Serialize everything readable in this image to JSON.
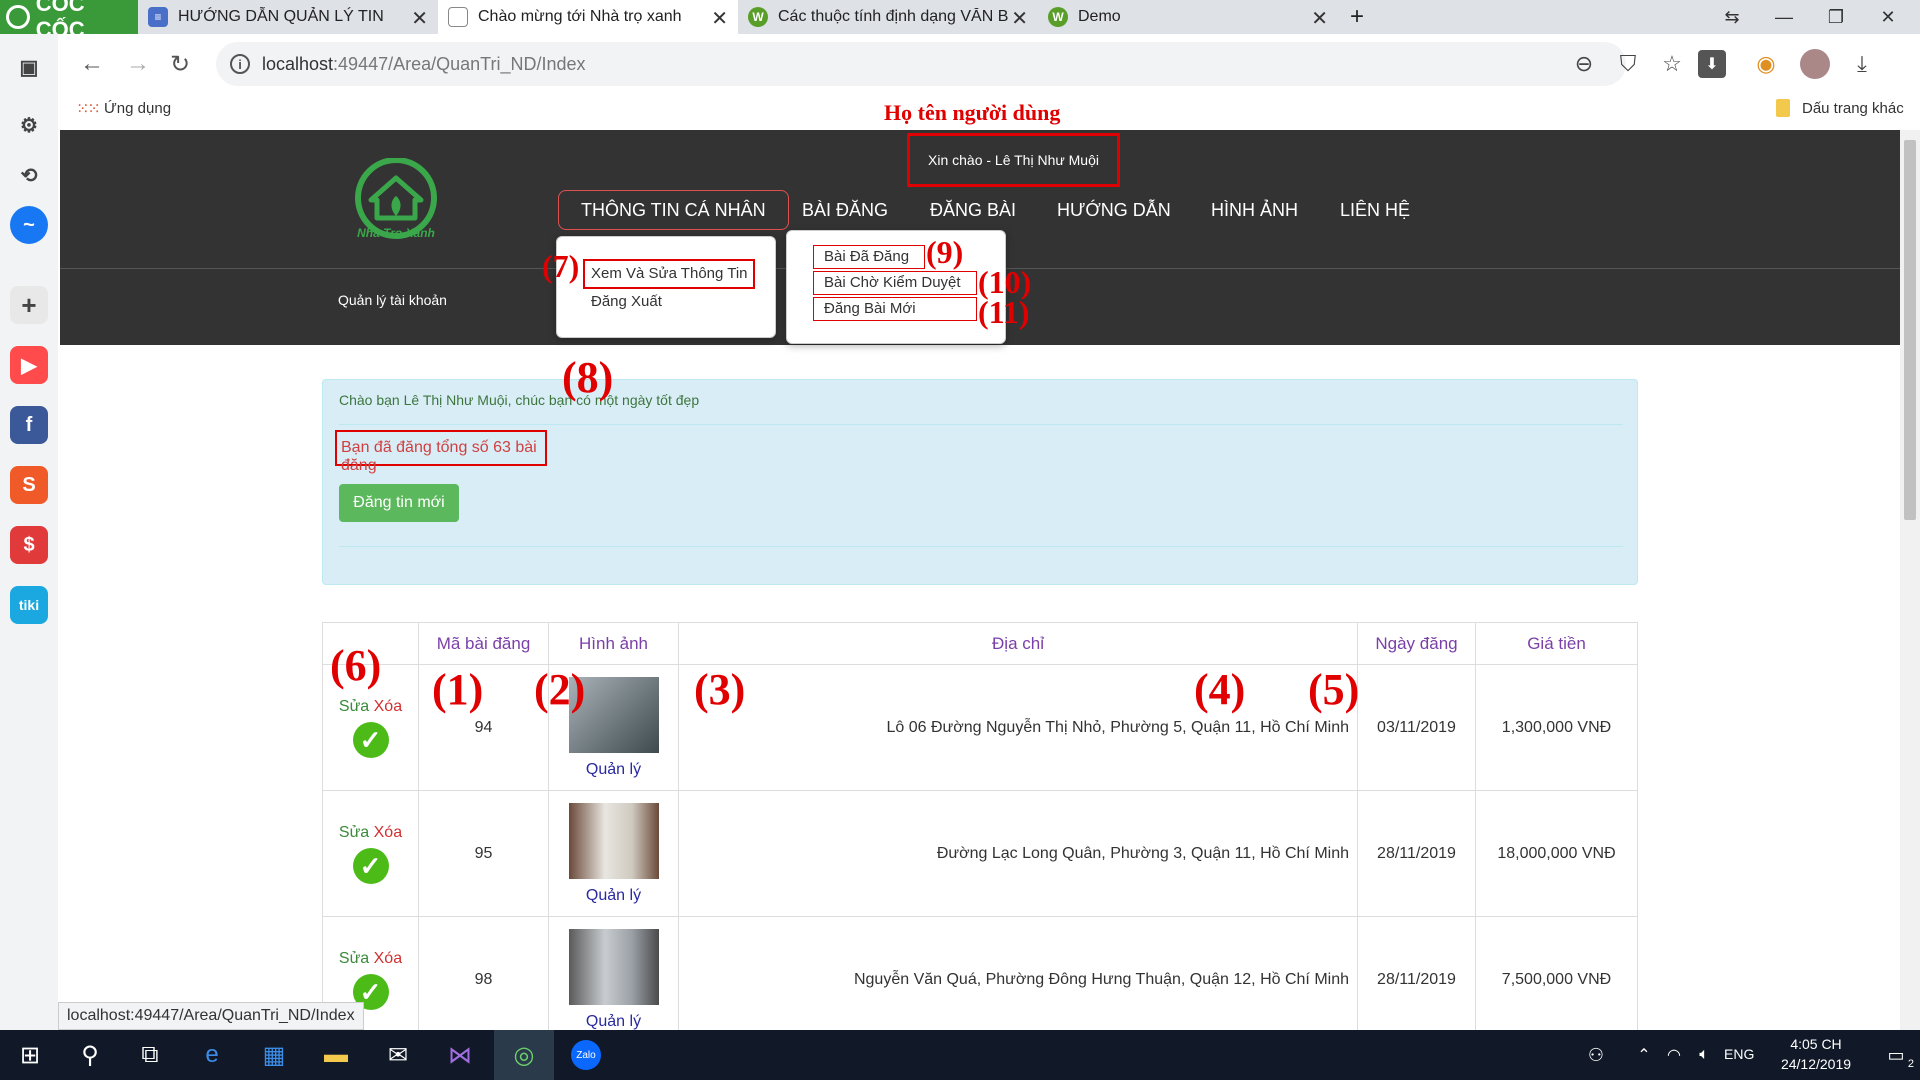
{
  "browser": {
    "brand": "CỐC CỐC",
    "tabs": [
      {
        "title": "HƯỚNG DẪN QUẢN LÝ TIN"
      },
      {
        "title": "Chào mừng tới Nhà trọ xanh"
      },
      {
        "title": "Các thuộc tính định dạng VĂN BẢN"
      },
      {
        "title": "Demo"
      }
    ],
    "url_host": "localhost",
    "url_path": ":49447/Area/QuanTri_ND/Index",
    "bookmarks_apps": "Ứng dụng",
    "bookmarks_other": "Dấu trang khác",
    "status_url": "localhost:49447/Area/QuanTri_ND/Index"
  },
  "site": {
    "logo_text": "Nha Tro Xanh",
    "annotation_username": "Họ tên người dùng",
    "greeting": "Xin chào - Lê Thị Như Muội",
    "menu": [
      "THÔNG TIN CÁ NHÂN",
      "BÀI ĐĂNG",
      "ĐĂNG BÀI",
      "HƯỚNG DẪN",
      "HÌNH ẢNH",
      "LIÊN HỆ"
    ],
    "account_label": "Quản lý tài khoản",
    "dropdown_personal": [
      "Xem Và Sửa Thông Tin",
      "Đăng Xuất"
    ],
    "dropdown_posts": [
      "Bài Đã Đăng",
      "Bài Chờ Kiểm Duyệt",
      "Đăng Bài Mới"
    ],
    "welcome": "Chào bạn Lê Thị Như Muội, chúc bạn có một ngày tốt đẹp",
    "total_posts": "Bạn đã đăng tổng số 63 bài đăng",
    "new_post_button": "Đăng tin mới",
    "annotations": [
      "(1)",
      "(2)",
      "(3)",
      "(4)",
      "(5)",
      "(6)",
      "(7)",
      "(8)",
      "(9)",
      "(10)",
      "(11)"
    ],
    "table": {
      "headers": [
        "Mã bài đăng",
        "Hình ảnh",
        "Địa chỉ",
        "Ngày đăng",
        "Giá tiền"
      ],
      "edit_label": "Sửa",
      "delete_label": "Xóa",
      "manage_label": "Quản lý",
      "rows": [
        {
          "id": "94",
          "address": "Lô 06 Đường Nguyễn Thị Nhỏ, Phường 5, Quận 11, Hồ Chí Minh",
          "date": "03/11/2019",
          "price": "1,300,000 VNĐ"
        },
        {
          "id": "95",
          "address": "Đường Lạc Long Quân, Phường 3, Quận 11, Hồ Chí Minh",
          "date": "28/11/2019",
          "price": "18,000,000 VNĐ"
        },
        {
          "id": "98",
          "address": "Nguyễn Văn Quá, Phường Đông Hưng Thuận, Quận 12, Hồ Chí Minh",
          "date": "28/11/2019",
          "price": "7,500,000 VNĐ"
        }
      ]
    }
  },
  "taskbar": {
    "lang": "ENG",
    "time": "4:05 CH",
    "date": "24/12/2019",
    "notifications": "2"
  }
}
